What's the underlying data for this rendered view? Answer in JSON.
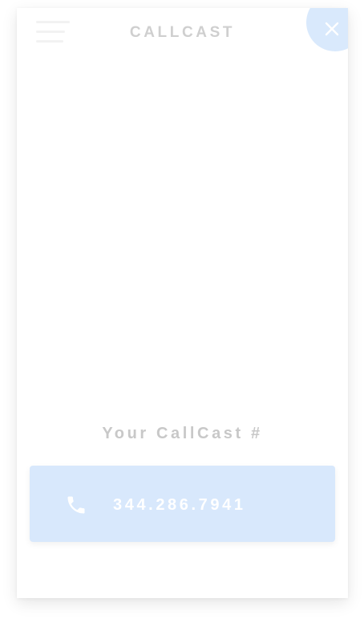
{
  "header": {
    "brand": "CALLCAST",
    "menu_icon": "hamburger-menu-icon",
    "close_icon": "close-icon"
  },
  "main": {
    "number_label": "Your CallCast #",
    "phone_number": "344.286.7941",
    "phone_icon": "phone-icon"
  },
  "colors": {
    "accent": "#d8e8fc",
    "brand_text": "#cfcfcf",
    "label_text": "#c8c8c8"
  }
}
